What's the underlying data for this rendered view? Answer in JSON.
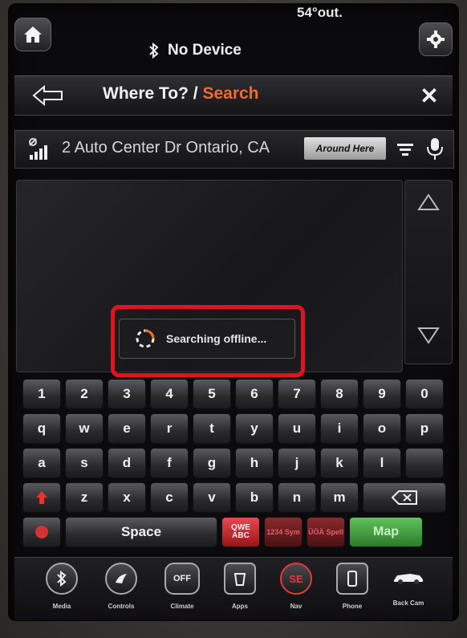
{
  "status": {
    "outside_temp": "54°out.",
    "device": "No Device"
  },
  "header": {
    "title_main": "Where To? / ",
    "title_accent": "Search",
    "close_label": "✕"
  },
  "search": {
    "address": "2 Auto Center Dr Ontario, CA",
    "around_label": "Around Here"
  },
  "toast": {
    "text": "Searching offline..."
  },
  "keyboard": {
    "row1": [
      "1",
      "2",
      "3",
      "4",
      "5",
      "6",
      "7",
      "8",
      "9",
      "0"
    ],
    "row2": [
      "q",
      "w",
      "e",
      "r",
      "t",
      "y",
      "u",
      "i",
      "o",
      "p"
    ],
    "row3": [
      "a",
      "s",
      "d",
      "f",
      "g",
      "h",
      "j",
      "k",
      "l",
      ""
    ],
    "row4": [
      "z",
      "x",
      "c",
      "v",
      "b",
      "n",
      "m"
    ],
    "space_label": "Space",
    "qwe_label": "QWE ABC",
    "num_label": "1234 Sym",
    "spell_label": "ÜÖÄ Spell",
    "map_label": "Map"
  },
  "dock": {
    "items": [
      {
        "label": "Media",
        "icon": "bluetooth-icon"
      },
      {
        "label": "Controls",
        "icon": "controls-icon"
      },
      {
        "label": "Climate",
        "icon": "climate-icon"
      },
      {
        "label": "Apps",
        "icon": "apps-icon"
      },
      {
        "label": "Nav",
        "icon": "nav-icon"
      },
      {
        "label": "Phone",
        "icon": "phone-icon"
      },
      {
        "label": "Back Cam",
        "icon": "backcam-icon"
      }
    ],
    "climate_text": "OFF",
    "nav_text": "SE"
  },
  "colors": {
    "accent": "#f26a2e",
    "highlight": "#e0141e",
    "map_key": "#3e9a3b"
  }
}
